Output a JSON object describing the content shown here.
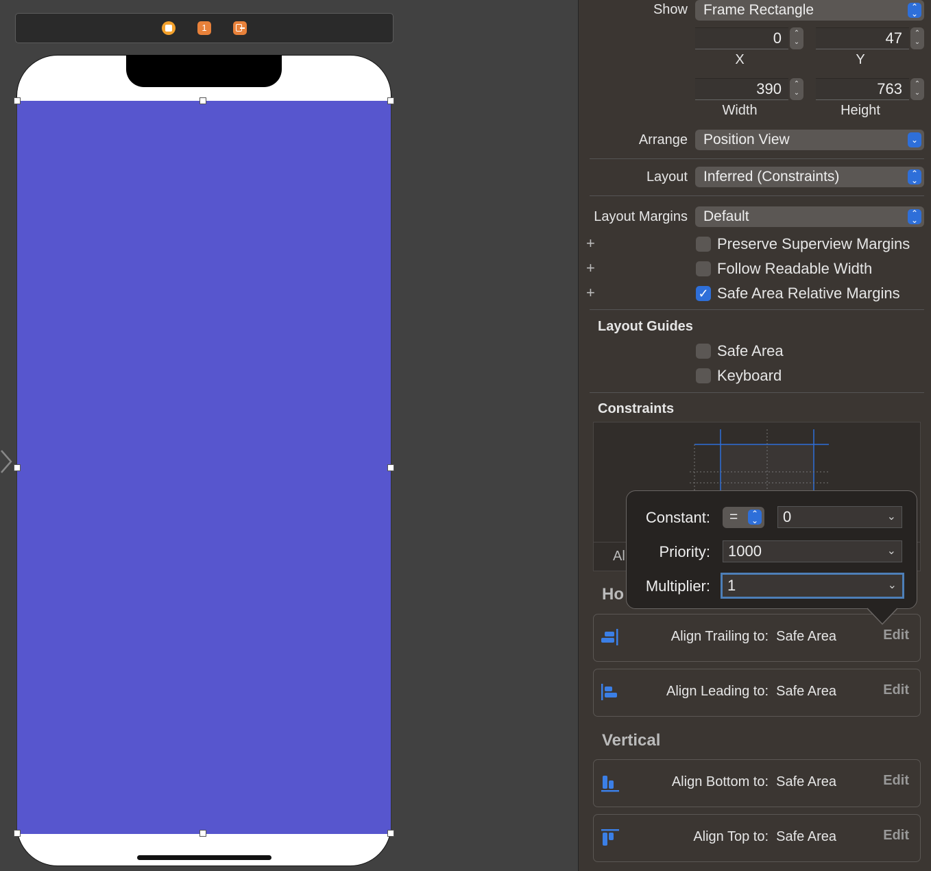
{
  "inspector": {
    "show": {
      "label": "Show",
      "value": "Frame Rectangle"
    },
    "x": {
      "value": "0",
      "label": "X"
    },
    "y": {
      "value": "47",
      "label": "Y"
    },
    "width": {
      "value": "390",
      "label": "Width"
    },
    "height": {
      "value": "763",
      "label": "Height"
    },
    "arrange": {
      "label": "Arrange",
      "value": "Position View"
    },
    "layout": {
      "label": "Layout",
      "value": "Inferred (Constraints)"
    },
    "layout_margins": {
      "label": "Layout Margins",
      "value": "Default"
    },
    "margin_options": [
      {
        "label": "Preserve Superview Margins",
        "checked": false
      },
      {
        "label": "Follow Readable Width",
        "checked": false
      },
      {
        "label": "Safe Area Relative Margins",
        "checked": true
      }
    ],
    "layout_guides": {
      "title": "Layout Guides",
      "items": [
        {
          "label": "Safe Area",
          "checked": false
        },
        {
          "label": "Keyboard",
          "checked": false
        }
      ]
    },
    "constraints_title": "Constraints",
    "partial_al": "Al",
    "horizontal_partial": "Ho",
    "vertical_title": "Vertical",
    "horizontal_constraints": [
      {
        "label": "Align Trailing to:",
        "target": "Safe Area",
        "edit": "Edit",
        "icon": "align-trailing-icon"
      },
      {
        "label": "Align Leading to:",
        "target": "Safe Area",
        "edit": "Edit",
        "icon": "align-leading-icon"
      }
    ],
    "vertical_constraints": [
      {
        "label": "Align Bottom to:",
        "target": "Safe Area",
        "edit": "Edit",
        "icon": "align-bottom-icon"
      },
      {
        "label": "Align Top to:",
        "target": "Safe Area",
        "edit": "Edit",
        "icon": "align-top-icon"
      }
    ]
  },
  "popover": {
    "constant_label": "Constant:",
    "relation": "=",
    "constant_value": "0",
    "priority_label": "Priority:",
    "priority_value": "1000",
    "multiplier_label": "Multiplier:",
    "multiplier_value": "1"
  },
  "colors": {
    "view_background": "#5756CE",
    "accent": "#2E6FD9"
  }
}
